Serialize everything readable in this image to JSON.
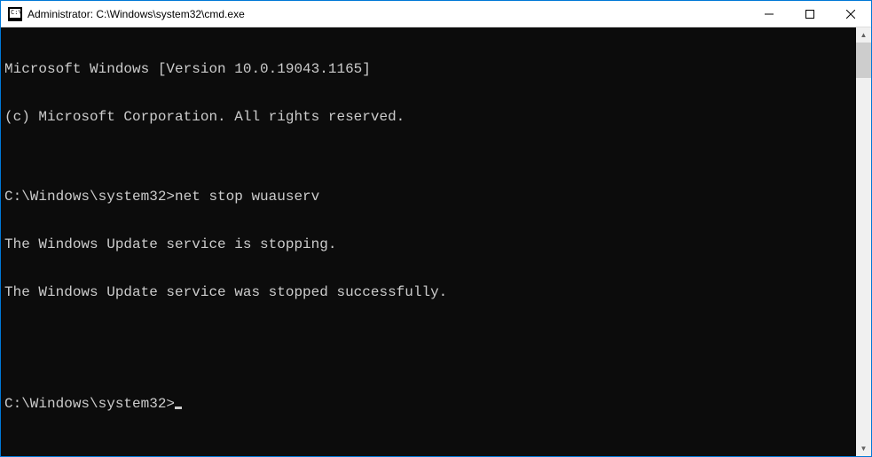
{
  "titlebar": {
    "icon_text": "C:\\",
    "title": "Administrator: C:\\Windows\\system32\\cmd.exe"
  },
  "terminal": {
    "lines": [
      "Microsoft Windows [Version 10.0.19043.1165]",
      "(c) Microsoft Corporation. All rights reserved.",
      "",
      "C:\\Windows\\system32>net stop wuauserv",
      "The Windows Update service is stopping.",
      "The Windows Update service was stopped successfully.",
      "",
      "",
      "C:\\Windows\\system32>"
    ],
    "prompt": "C:\\Windows\\system32>"
  }
}
